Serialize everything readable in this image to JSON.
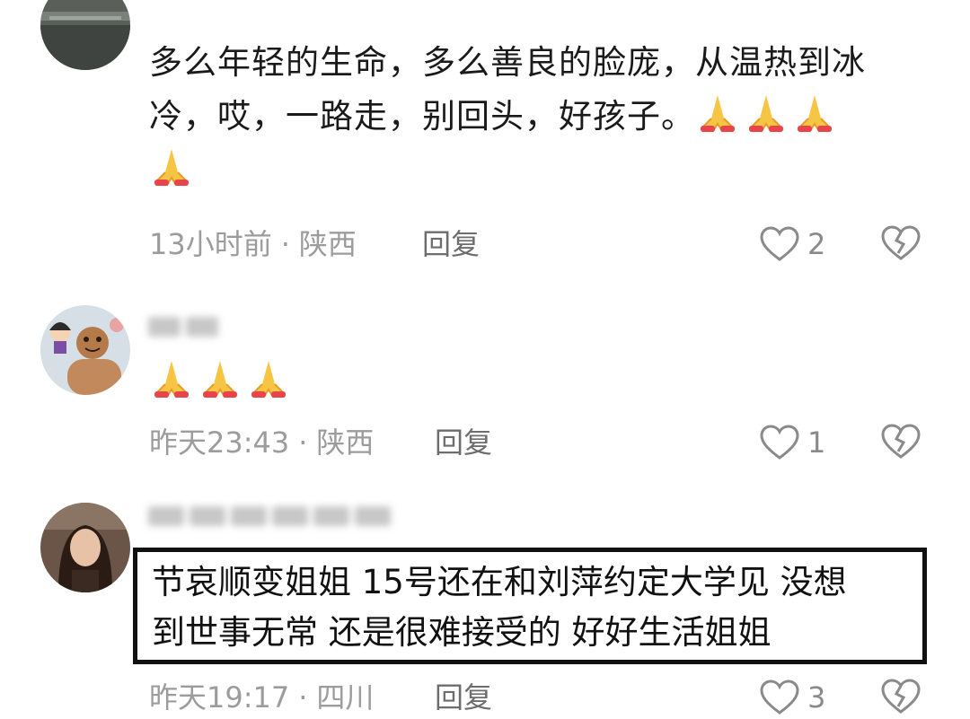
{
  "comments": [
    {
      "text_line1": "多么年轻的生命，多么善良的脸庞，从温热到冰",
      "text_line2": "冷，哎，一路走，别回头，好孩子。",
      "emoji": "folded-hands",
      "time": "13小时前",
      "location": "陕西",
      "reply_label": "回复",
      "likes": "2"
    },
    {
      "emoji": "folded-hands",
      "time": "昨天23:43",
      "location": "陕西",
      "reply_label": "回复",
      "likes": "1"
    },
    {
      "text_line1": "节哀顺变姐姐 15号还在和刘萍约定大学见 没想",
      "text_line2": "到世事无常 还是很难接受的 好好生活姐姐",
      "time": "昨天19:17",
      "location": "四川",
      "reply_label": "回复",
      "likes": "3"
    }
  ],
  "meta_separator": "·",
  "icons": {
    "like": "heart-outline-icon",
    "dislike": "broken-heart-icon"
  },
  "colors": {
    "text": "#1a1a1a",
    "meta": "#9c9c9c",
    "reply": "#6d6d6d",
    "highlight_border": "#111111"
  }
}
